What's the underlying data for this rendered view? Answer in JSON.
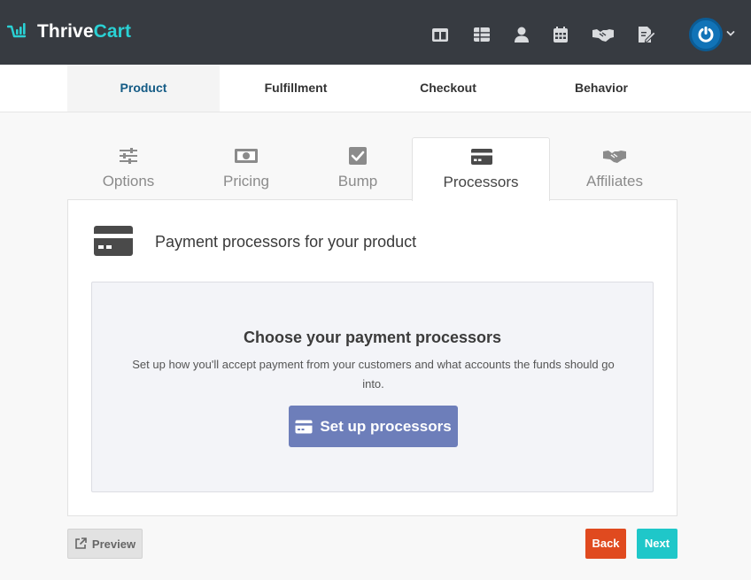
{
  "app": {
    "logo_thrive": "Thrive",
    "logo_cart": "Cart",
    "brand_teal": "#2ad1d4",
    "brand_dark": "#373b41"
  },
  "top_nav": {
    "icons": [
      "layout-columns-icon",
      "table-icon",
      "user-icon",
      "calendar-icon",
      "handshake-icon",
      "edit-document-icon"
    ],
    "avatar_icon": "power-icon",
    "caret_icon": "chevron-down-icon"
  },
  "main_tabs": [
    {
      "label": "Product",
      "active": true
    },
    {
      "label": "Fulfillment",
      "active": false
    },
    {
      "label": "Checkout",
      "active": false
    },
    {
      "label": "Behavior",
      "active": false
    }
  ],
  "sub_tabs": [
    {
      "label": "Options",
      "icon": "sliders-icon",
      "active": false
    },
    {
      "label": "Pricing",
      "icon": "money-bill-icon",
      "active": false
    },
    {
      "label": "Bump",
      "icon": "checkbox-icon",
      "active": false
    },
    {
      "label": "Processors",
      "icon": "credit-card-icon",
      "active": true
    },
    {
      "label": "Affiliates",
      "icon": "handshake-icon",
      "active": false
    }
  ],
  "panel": {
    "heading": "Payment processors for your product",
    "inner_title": "Choose your payment processors",
    "inner_desc": "Set up how you'll accept payment from your customers and what accounts the funds should go into.",
    "setup_button": "Set up processors"
  },
  "footer": {
    "preview": "Preview",
    "back": "Back",
    "next": "Next",
    "back_color": "#e04a1f",
    "next_color": "#1fc7c9"
  }
}
